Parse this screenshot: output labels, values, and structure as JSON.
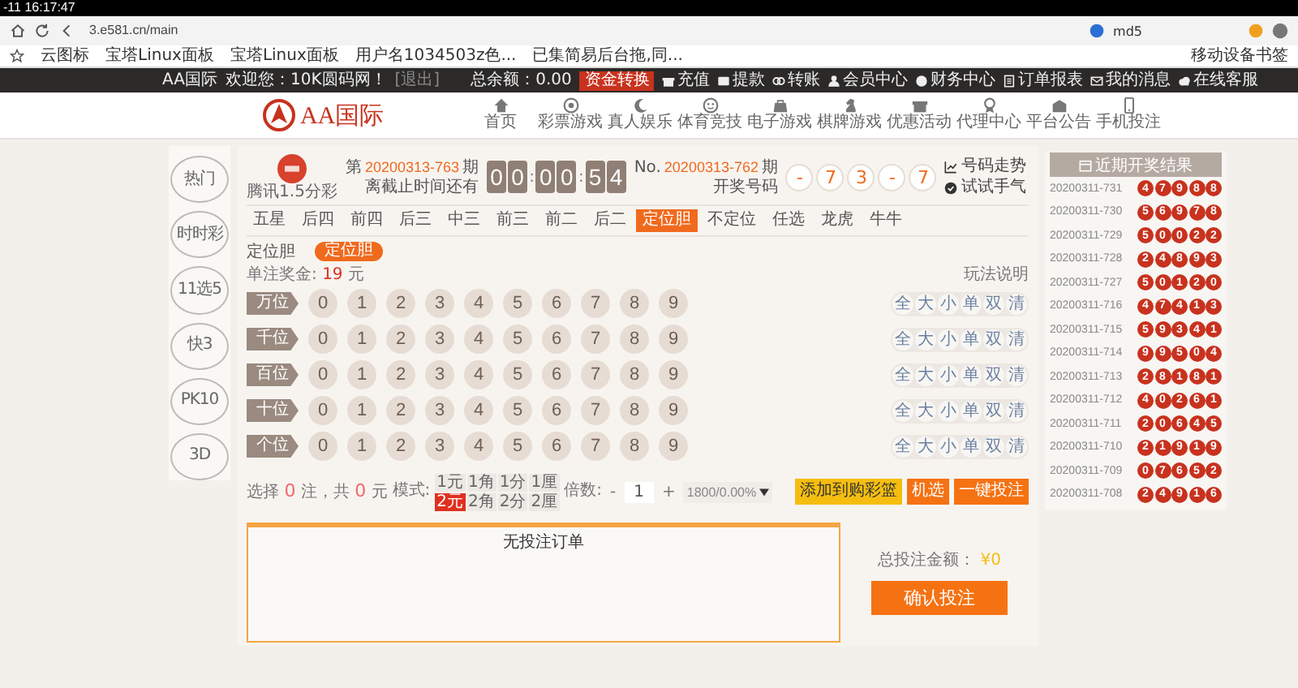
{
  "browser": {
    "clock": "-11 16:17:47",
    "url": "3.e581.cn/main",
    "profile": "md5",
    "bookmarks": [
      "云图标",
      "宝塔Linux面板",
      "宝塔Linux面板",
      "用户名1034503z色...",
      "已集简易后台拖,同..."
    ],
    "mobile_bookmarks": "移动设备书签"
  },
  "top_bar": {
    "brand": "AA国际",
    "welcome": "欢迎您：10K圆码网！",
    "logout": "[退出]",
    "balance": "总余额：0.00",
    "transfer": "资金转换",
    "links": [
      "充值",
      "提款",
      "转账",
      "会员中心",
      "财务中心",
      "订单报表",
      "我的消息",
      "在线客服"
    ]
  },
  "header": {
    "logo": "AA国际",
    "nav": [
      "首页",
      "彩票游戏",
      "真人娱乐",
      "体育竞技",
      "电子游戏",
      "棋牌游戏",
      "优惠活动",
      "代理中心",
      "平台公告",
      "手机投注"
    ]
  },
  "sidebar": [
    {
      "label": "热门",
      "selected": false
    },
    {
      "label": "时时彩",
      "selected": false
    },
    {
      "label": "11选5",
      "selected": false
    },
    {
      "label": "快3",
      "selected": false
    },
    {
      "label": "PK10",
      "selected": false
    },
    {
      "label": "3D",
      "selected": false
    }
  ],
  "game": {
    "name": "腾讯1.5分彩",
    "issue_prefix": "第",
    "issue": "20200313-763",
    "issue_suffix": "期",
    "deadline": "离截止时间还有",
    "timer": [
      "0",
      "0",
      ":",
      "0",
      "0",
      ":",
      "5",
      "4"
    ],
    "last_prefix": "No.",
    "last_issue": "20200313-762",
    "last_suffix": "期",
    "draw_label": "开奖号码",
    "result": [
      "-",
      "7",
      "3",
      "-",
      "7"
    ],
    "trend": "号码走势",
    "try_luck": "试试手气"
  },
  "tabs": [
    {
      "label": "五星",
      "selected": false
    },
    {
      "label": "后四",
      "selected": false
    },
    {
      "label": "前四",
      "selected": false
    },
    {
      "label": "后三",
      "selected": false
    },
    {
      "label": "中三",
      "selected": false
    },
    {
      "label": "前三",
      "selected": false
    },
    {
      "label": "前二",
      "selected": false
    },
    {
      "label": "后二",
      "selected": false
    },
    {
      "label": "定位胆",
      "selected": true
    },
    {
      "label": "不定位",
      "selected": false
    },
    {
      "label": "任选",
      "selected": false
    },
    {
      "label": "龙虎",
      "selected": false
    },
    {
      "label": "牛牛",
      "selected": false
    }
  ],
  "subtabs": {
    "label": "定位胆",
    "options": [
      {
        "label": "定位胆",
        "selected": true
      }
    ]
  },
  "prize": {
    "label": "单注奖金:",
    "amount": "19",
    "unit": "元"
  },
  "rules": "玩法说明",
  "positions": [
    {
      "label": "万位",
      "digits": [
        {
          "n": "0",
          "selected": false
        },
        {
          "n": "1",
          "selected": false
        },
        {
          "n": "2",
          "selected": false
        },
        {
          "n": "3",
          "selected": false
        },
        {
          "n": "4",
          "selected": false
        },
        {
          "n": "5",
          "selected": false
        },
        {
          "n": "6",
          "selected": false
        },
        {
          "n": "7",
          "selected": false
        },
        {
          "n": "8",
          "selected": false
        },
        {
          "n": "9",
          "selected": false
        }
      ],
      "quick": [
        "全",
        "大",
        "小",
        "单",
        "双",
        "清"
      ]
    },
    {
      "label": "千位",
      "digits": [
        {
          "n": "0",
          "selected": false
        },
        {
          "n": "1",
          "selected": false
        },
        {
          "n": "2",
          "selected": false
        },
        {
          "n": "3",
          "selected": false
        },
        {
          "n": "4",
          "selected": false
        },
        {
          "n": "5",
          "selected": false
        },
        {
          "n": "6",
          "selected": false
        },
        {
          "n": "7",
          "selected": false
        },
        {
          "n": "8",
          "selected": false
        },
        {
          "n": "9",
          "selected": false
        }
      ],
      "quick": [
        "全",
        "大",
        "小",
        "单",
        "双",
        "清"
      ]
    },
    {
      "label": "百位",
      "digits": [
        {
          "n": "0",
          "selected": false
        },
        {
          "n": "1",
          "selected": false
        },
        {
          "n": "2",
          "selected": false
        },
        {
          "n": "3",
          "selected": false
        },
        {
          "n": "4",
          "selected": false
        },
        {
          "n": "5",
          "selected": false
        },
        {
          "n": "6",
          "selected": false
        },
        {
          "n": "7",
          "selected": false
        },
        {
          "n": "8",
          "selected": false
        },
        {
          "n": "9",
          "selected": false
        }
      ],
      "quick": [
        "全",
        "大",
        "小",
        "单",
        "双",
        "清"
      ]
    },
    {
      "label": "十位",
      "digits": [
        {
          "n": "0",
          "selected": false
        },
        {
          "n": "1",
          "selected": false
        },
        {
          "n": "2",
          "selected": false
        },
        {
          "n": "3",
          "selected": false
        },
        {
          "n": "4",
          "selected": false
        },
        {
          "n": "5",
          "selected": false
        },
        {
          "n": "6",
          "selected": false
        },
        {
          "n": "7",
          "selected": false
        },
        {
          "n": "8",
          "selected": false
        },
        {
          "n": "9",
          "selected": false
        }
      ],
      "quick": [
        "全",
        "大",
        "小",
        "单",
        "双",
        "清"
      ]
    },
    {
      "label": "个位",
      "digits": [
        {
          "n": "0",
          "selected": false
        },
        {
          "n": "1",
          "selected": false
        },
        {
          "n": "2",
          "selected": false
        },
        {
          "n": "3",
          "selected": false
        },
        {
          "n": "4",
          "selected": false
        },
        {
          "n": "5",
          "selected": false
        },
        {
          "n": "6",
          "selected": false
        },
        {
          "n": "7",
          "selected": false
        },
        {
          "n": "8",
          "selected": false
        },
        {
          "n": "9",
          "selected": false
        }
      ],
      "quick": [
        "全",
        "大",
        "小",
        "单",
        "双",
        "清"
      ]
    }
  ],
  "bet": {
    "pre": "选择",
    "count": "0",
    "mid": "注，共",
    "total": "0",
    "post": "元",
    "mode_label": "模式:",
    "modes": [
      {
        "label": "1元",
        "selected": false
      },
      {
        "label": "1角",
        "selected": false
      },
      {
        "label": "1分",
        "selected": false
      },
      {
        "label": "1厘",
        "selected": false
      },
      {
        "label": "2元",
        "selected": true
      },
      {
        "label": "2角",
        "selected": false
      },
      {
        "label": "2分",
        "selected": false
      },
      {
        "label": "2厘",
        "selected": false
      }
    ],
    "multiplier_label": "倍数:",
    "minus": "-",
    "multiplier": "1",
    "plus": "+",
    "rebate": "1800/0.00%",
    "buttons": [
      {
        "label": "添加到购彩篮",
        "kind": "basket"
      },
      {
        "label": "机选",
        "kind": "primary"
      },
      {
        "label": "一键投注",
        "kind": "primary"
      }
    ]
  },
  "orders": {
    "empty": "无投注订单",
    "total_label": "总投注金额：",
    "total_amount": "¥0",
    "confirm": "确认投注"
  },
  "recent": {
    "title": "近期开奖结果",
    "draws": [
      {
        "issue": "20200311-731",
        "balls": [
          "4",
          "7",
          "9",
          "8",
          "8"
        ]
      },
      {
        "issue": "20200311-730",
        "balls": [
          "5",
          "6",
          "9",
          "7",
          "8"
        ]
      },
      {
        "issue": "20200311-729",
        "balls": [
          "5",
          "0",
          "0",
          "2",
          "2"
        ]
      },
      {
        "issue": "20200311-728",
        "balls": [
          "2",
          "4",
          "8",
          "9",
          "3"
        ]
      },
      {
        "issue": "20200311-727",
        "balls": [
          "5",
          "0",
          "1",
          "2",
          "0"
        ]
      },
      {
        "issue": "20200311-716",
        "balls": [
          "4",
          "7",
          "4",
          "1",
          "3"
        ]
      },
      {
        "issue": "20200311-715",
        "balls": [
          "5",
          "9",
          "3",
          "4",
          "1"
        ]
      },
      {
        "issue": "20200311-714",
        "balls": [
          "9",
          "9",
          "5",
          "0",
          "4"
        ]
      },
      {
        "issue": "20200311-713",
        "balls": [
          "2",
          "8",
          "1",
          "8",
          "1"
        ]
      },
      {
        "issue": "20200311-712",
        "balls": [
          "4",
          "0",
          "2",
          "6",
          "1"
        ]
      },
      {
        "issue": "20200311-711",
        "balls": [
          "2",
          "0",
          "6",
          "4",
          "5"
        ]
      },
      {
        "issue": "20200311-710",
        "balls": [
          "2",
          "1",
          "9",
          "1",
          "9"
        ]
      },
      {
        "issue": "20200311-709",
        "balls": [
          "0",
          "7",
          "6",
          "5",
          "2"
        ]
      },
      {
        "issue": "20200311-708",
        "balls": [
          "2",
          "4",
          "9",
          "1",
          "6"
        ]
      }
    ]
  }
}
